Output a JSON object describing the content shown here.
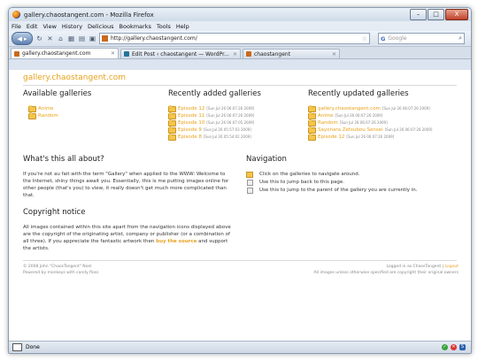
{
  "window": {
    "title": "gallery.chaostangent.com - Mozilla Firefox",
    "min": "–",
    "max": "□",
    "close": "X"
  },
  "menu": [
    "File",
    "Edit",
    "View",
    "History",
    "Delicious",
    "Bookmarks",
    "Tools",
    "Help"
  ],
  "nav": {
    "url": "http://gallery.chaostangent.com/",
    "search_placeholder": "Google"
  },
  "tabs": [
    {
      "label": "gallery.chaostangent.com"
    },
    {
      "label": "Edit Post ‹ chaostangent — WordPr..."
    },
    {
      "label": "chaostangent"
    }
  ],
  "page": {
    "site_title": "gallery.chaostangent.com",
    "available": {
      "heading": "Available galleries",
      "items": [
        "Anime",
        "Random"
      ]
    },
    "recently_added": {
      "heading": "Recently added galleries",
      "items": [
        {
          "name": "Episode 12",
          "ts": "[Sun Jul 26 06:07:26 2009]"
        },
        {
          "name": "Episode 11",
          "ts": "[Sun Jul 26 06:07:26 2009]"
        },
        {
          "name": "Episode 10",
          "ts": "[Sun Jul 26 06:07:05 2009]"
        },
        {
          "name": "Episode 9",
          "ts": "[Sun Jul 26 05:57:03 2009]"
        },
        {
          "name": "Episode 8",
          "ts": "[Sun Jul 26 05:54:02 2009]"
        }
      ]
    },
    "recently_updated": {
      "heading": "Recently updated galleries",
      "items": [
        {
          "name": "gallery.chaostangent.com",
          "ts": "[Sun Jul 26 06:07:26 2009]"
        },
        {
          "name": "Anime",
          "ts": "[Sun Jul 26 06:07:26 2009]"
        },
        {
          "name": "Random",
          "ts": "[Sun Jul 26 06:07:26 2009]"
        },
        {
          "name": "Sayonara Zetsubou Sensei",
          "ts": "[Sun Jul 26 06:07:26 2009]"
        },
        {
          "name": "Episode 12",
          "ts": "[Sun Jul 26 06:07:26 2009]"
        }
      ]
    },
    "about": {
      "heading": "What's this all about?",
      "text": "If you're not au fait with the term \"Gallery\" when applied to the WWW: Welcome to the Internet, shiny things await you. Essentially, this is me putting images online for other people (that's you) to view, it really doesn't get much more complicated than that."
    },
    "copyright": {
      "heading": "Copyright notice",
      "text_before": "All images contained within this site apart from the navigation icons displayed above are the copyright of the originating artist, company or publisher (or a combination of all three). If you appreciate the fantastic artwork then ",
      "link": "buy the source",
      "text_after": " and support the artists."
    },
    "navigation": {
      "heading": "Navigation",
      "items": [
        "Click on the galleries to navigate around.",
        "Use this to jump back to this page.",
        "Use this to jump to the parent of the gallery you are currently in."
      ]
    },
    "footer": {
      "left1": "© 2008 John \"ChaosTangent\" Noel",
      "left2": "Powered by monkeys with candy floss",
      "right1_prefix": "Logged in as ChaosTangent | ",
      "logout": "Logout",
      "right2": "All images unless otherwise specified are copyright their original owners"
    }
  },
  "status": {
    "text": "Done"
  }
}
